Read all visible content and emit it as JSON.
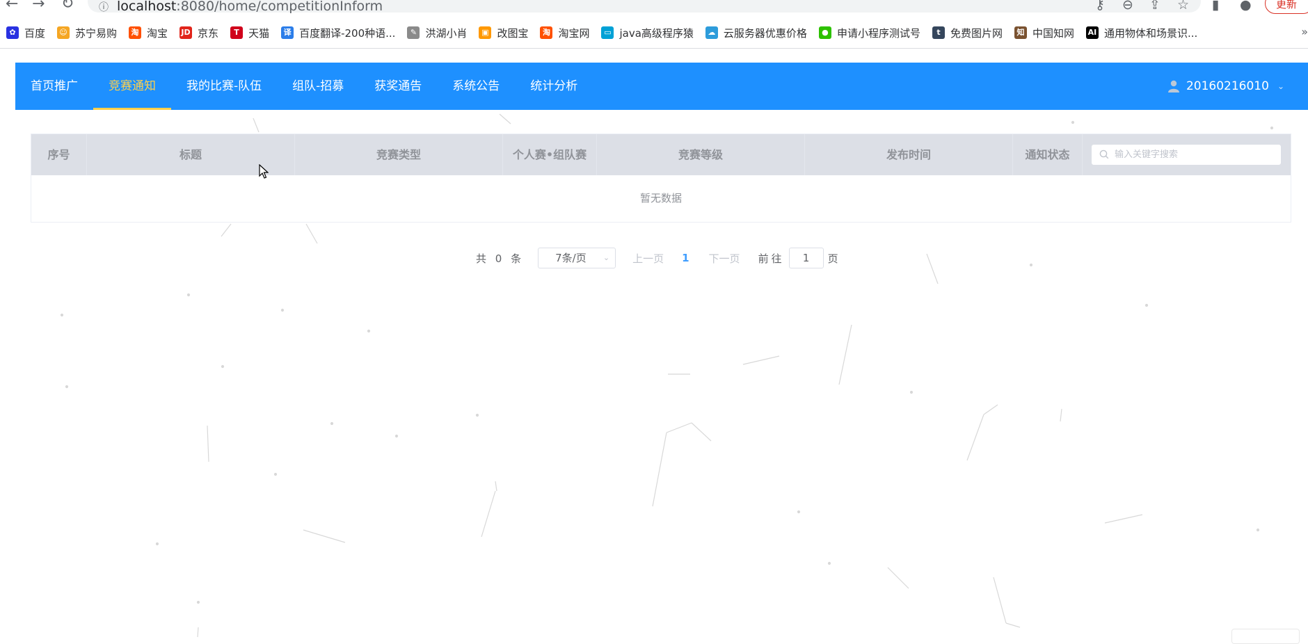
{
  "browser": {
    "url_host": "localhost",
    "url_path": ":8080/home/competitionInform",
    "update_label": "更新",
    "bookmarks": [
      {
        "label": "百度",
        "color": "#2932e1",
        "glyph": "✿"
      },
      {
        "label": "苏宁易购",
        "color": "#f5a623",
        "glyph": "☺"
      },
      {
        "label": "淘宝",
        "color": "#ff5000",
        "glyph": "淘"
      },
      {
        "label": "京东",
        "color": "#e1251b",
        "glyph": "JD"
      },
      {
        "label": "天猫",
        "color": "#d0021b",
        "glyph": "T"
      },
      {
        "label": "百度翻译-200种语...",
        "color": "#2b7de9",
        "glyph": "译"
      },
      {
        "label": "洪湖小肖",
        "color": "#8a8a8a",
        "glyph": "✎"
      },
      {
        "label": "改图宝",
        "color": "#ff9800",
        "glyph": "▣"
      },
      {
        "label": "淘宝网",
        "color": "#ff5000",
        "glyph": "淘"
      },
      {
        "label": "java高级程序猿",
        "color": "#00a1d6",
        "glyph": "▭"
      },
      {
        "label": "云服务器优惠价格",
        "color": "#2d9cdb",
        "glyph": "☁"
      },
      {
        "label": "申请小程序测试号",
        "color": "#2dc100",
        "glyph": "●"
      },
      {
        "label": "免费图片网",
        "color": "#35465c",
        "glyph": "t"
      },
      {
        "label": "中国知网",
        "color": "#7a5230",
        "glyph": "知"
      },
      {
        "label": "通用物体和场景识...",
        "color": "#000000",
        "glyph": "AI"
      }
    ]
  },
  "header": {
    "menu": [
      {
        "label": "首页推广",
        "active": false
      },
      {
        "label": "竞赛通知",
        "active": true
      },
      {
        "label": "我的比赛-队伍",
        "active": false
      },
      {
        "label": "组队-招募",
        "active": false
      },
      {
        "label": "获奖通告",
        "active": false
      },
      {
        "label": "系统公告",
        "active": false
      },
      {
        "label": "统计分析",
        "active": false
      }
    ],
    "username": "20160216010",
    "accent_color": "#1e90ff",
    "active_color": "#ffd04b"
  },
  "table": {
    "columns": [
      "序号",
      "标题",
      "竞赛类型",
      "个人赛•组队赛",
      "竞赛等级",
      "发布时间",
      "通知状态"
    ],
    "search_placeholder": "输入关键字搜索",
    "empty_text": "暂无数据",
    "rows": []
  },
  "pagination": {
    "total_text": "共 0 条",
    "page_size": "7条/页",
    "prev_label": "上一页",
    "current_page": "1",
    "next_label": "下一页",
    "goto_label": "前往",
    "goto_value": "1",
    "page_unit": "页"
  }
}
